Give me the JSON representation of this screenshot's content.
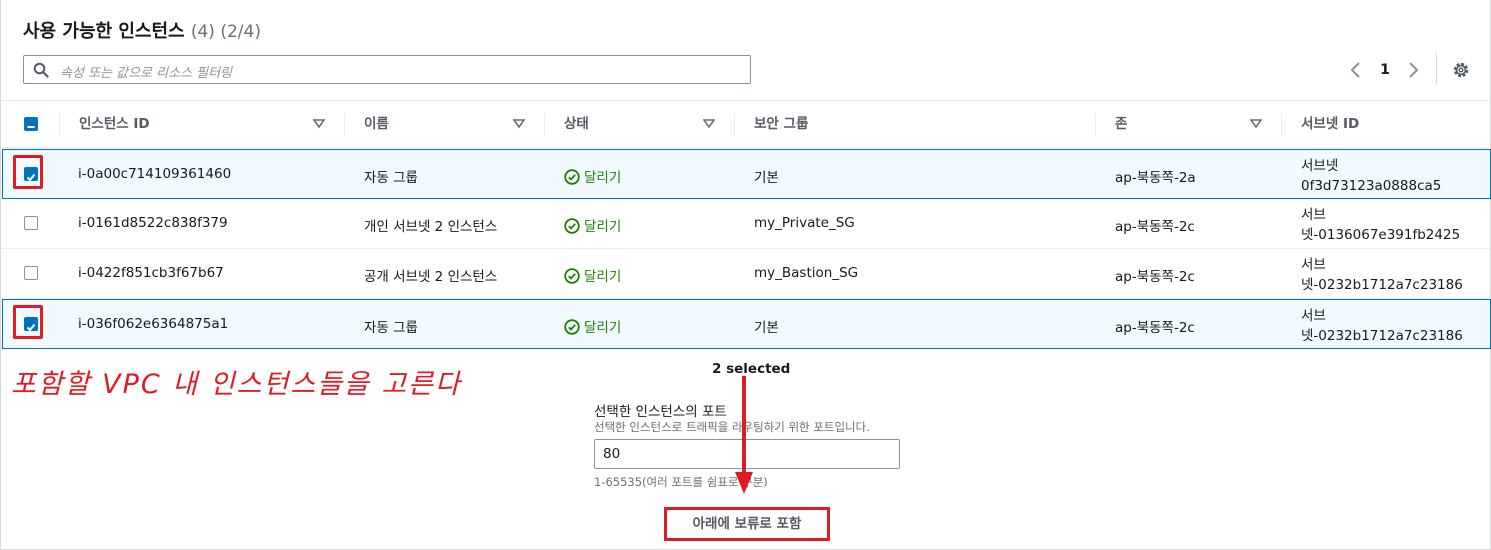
{
  "header": {
    "title": "사용 가능한 인스턴스",
    "count": "(4) (2/4)"
  },
  "search": {
    "placeholder": "속성 또는 값으로 리소스 필터링"
  },
  "pagination": {
    "page": "1"
  },
  "columns": [
    "인스턴스 ID",
    "이름",
    "상태",
    "보안 그룹",
    "존",
    "서브넷 ID"
  ],
  "rows": [
    {
      "selected": true,
      "id": "i-0a00c714109361460",
      "name": "자동 그룹",
      "state": "달리기",
      "sg": "기본",
      "zone": "ap-북동쪽-2a",
      "subnet_l1": "서브넷",
      "subnet_l2": "0f3d73123a0888ca5"
    },
    {
      "selected": false,
      "id": "i-0161d8522c838f379",
      "name": "개인 서브넷 2 인스턴스",
      "state": "달리기",
      "sg": "my_Private_SG",
      "zone": "ap-북동쪽-2c",
      "subnet_l1": "서브",
      "subnet_l2": "넷-0136067e391fb2425"
    },
    {
      "selected": false,
      "id": "i-0422f851cb3f67b67",
      "name": "공개 서브넷 2 인스턴스",
      "state": "달리기",
      "sg": "my_Bastion_SG",
      "zone": "ap-북동쪽-2c",
      "subnet_l1": "서브",
      "subnet_l2": "넷-0232b1712a7c23186"
    },
    {
      "selected": true,
      "id": "i-036f062e6364875a1",
      "name": "자동 그룹",
      "state": "달리기",
      "sg": "기본",
      "zone": "ap-북동쪽-2c",
      "subnet_l1": "서브",
      "subnet_l2": "넷-0232b1712a7c23186"
    }
  ],
  "selection": {
    "count_label": "2 selected"
  },
  "annotation": "포함할 VPC 내 인스턴스들을 고른다",
  "port": {
    "label": "선택한 인스턴스의 포트",
    "description": "선택한 인스턴스로 트래픽을 라우팅하기 위한 포트입니다.",
    "value": "80",
    "hint": "1-65535(여러 포트를 쉼표로 구분)"
  },
  "include_button": "아래에 보류로 포함",
  "colors": {
    "accent": "#0073bb",
    "running": "#1d8102",
    "annotation": "#e01b24"
  }
}
